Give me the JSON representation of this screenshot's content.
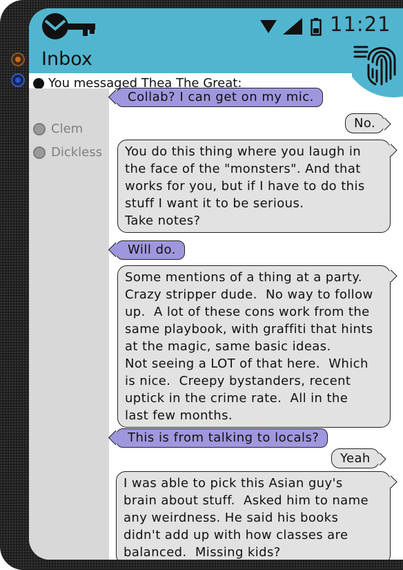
{
  "status_bar": {
    "time": "11:21"
  },
  "header": {
    "title": "Inbox"
  },
  "thread": {
    "header": "You messaged Thea The Great:"
  },
  "sidebar": {
    "contacts": [
      "Clem",
      "Dickless"
    ]
  },
  "messages": [
    {
      "from": "me",
      "lines": [
        "Collab?  I can get on my mic."
      ]
    },
    {
      "from": "them",
      "lines": [
        "No."
      ]
    },
    {
      "from": "them",
      "lines": [
        "You do this thing where you laugh in",
        "the face of the \"monsters\". And that",
        "works for you, but if I have to do this",
        "stuff I want it to be serious.",
        "Take notes?"
      ]
    },
    {
      "from": "me",
      "lines": [
        "Will do."
      ]
    },
    {
      "from": "them",
      "lines": [
        "Some mentions of a thing at a party.",
        "Crazy stripper dude.  No way to follow",
        "up.  A lot of these cons work from the",
        "same playbook, with graffiti that hints",
        "at the magic, same basic ideas.",
        "Not seeing a LOT of that here.  Which",
        "is nice.  Creepy bystanders, recent",
        "uptick in the crime rate.  All in the",
        "last few months."
      ]
    },
    {
      "from": "me",
      "lines": [
        "This is from talking to locals?"
      ]
    },
    {
      "from": "them",
      "lines": [
        "Yeah"
      ]
    },
    {
      "from": "them",
      "lines": [
        "I was able to pick this Asian guy's",
        "brain about stuff.  Asked him to name",
        "any weirdness. He said his books",
        "didn't add up with how classes are",
        "balanced.  Missing kids?"
      ]
    }
  ],
  "colors": {
    "accent": "#52b5d0",
    "outgoing_bubble": "#9f97de",
    "incoming_bubble": "#e2e2e2",
    "sidebar": "#d8d8d8"
  }
}
